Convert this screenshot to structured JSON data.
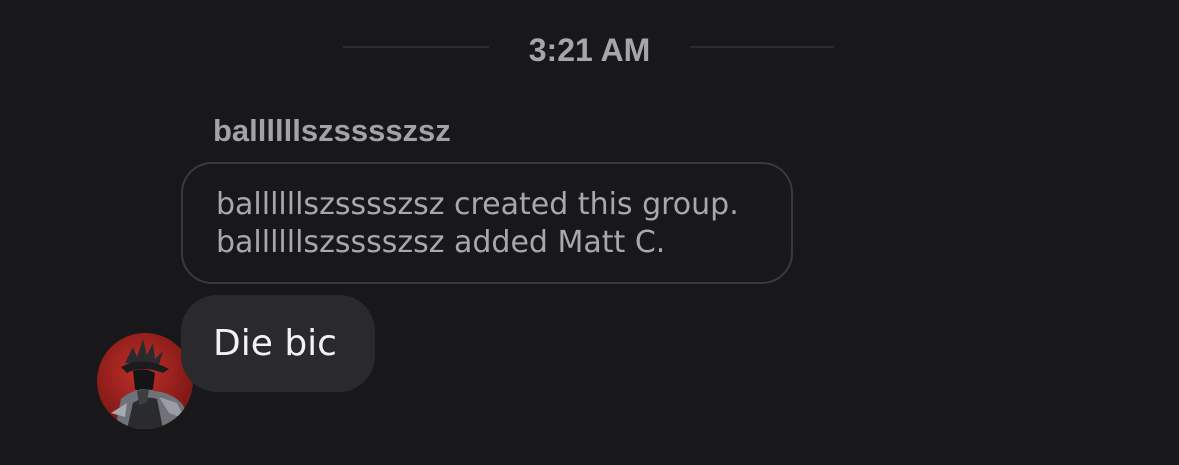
{
  "chat": {
    "timestamp": "3:21 AM",
    "sender": "ballllllszsssszsz",
    "system_messages": [
      "ballllllszsssszsz created this group.",
      "ballllllszsssszsz added Matt C."
    ],
    "message": "Die bic"
  },
  "colors": {
    "background": "#18181a",
    "bubble": "#2a2a2c",
    "muted_text": "#a6a6a8",
    "avatar_bg": "#8e1d1a"
  }
}
